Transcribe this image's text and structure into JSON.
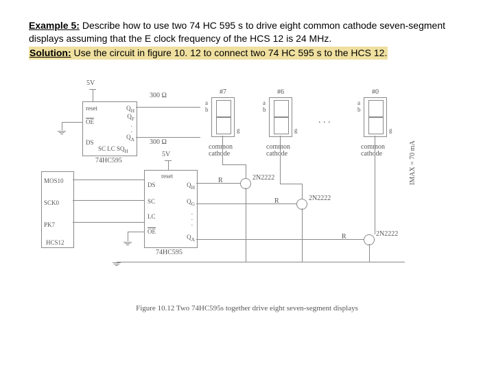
{
  "header": {
    "example_label": "Example 5:",
    "problem": " Describe how to use two 74 HC 595 s to drive eight common cathode seven-segment displays assuming that the E clock frequency of the HCS 12 is 24 MHz.",
    "solution_label": "Solution:",
    "solution_text": " Use the circuit in figure 10. 12 to connect two 74 HC 595 s to the HCS 12."
  },
  "diagram": {
    "supply1": "5V",
    "supply2": "5V",
    "chip1": {
      "name": "74HC595",
      "pins_left": [
        "OE",
        "DS",
        "SC",
        "LC",
        "SQH"
      ],
      "pins_right_top": "QH",
      "pins_right_bottom": "QA",
      "reset": "reset"
    },
    "chip2": {
      "name": "74HC595",
      "pins_left": [
        "DS",
        "SC",
        "LC",
        "OE"
      ],
      "pins_right_top": "QH",
      "pins_right_mid": "QG",
      "pins_right_bottom": "QA",
      "reset": "reset"
    },
    "mcu": {
      "name": "HCS12",
      "pins": [
        "MOS10",
        "SCK0",
        "PK7"
      ]
    },
    "resistors": {
      "top": "300 Ω",
      "bottom": "300 Ω",
      "base": "R"
    },
    "displays": [
      {
        "num": "#7",
        "cathode": "common\ncathode",
        "a": "a",
        "b": "b",
        "g": "g"
      },
      {
        "num": "#6",
        "cathode": "common\ncathode",
        "a": "a",
        "b": "b",
        "g": "g"
      },
      {
        "num": "#0",
        "cathode": "common\ncathode",
        "a": "a",
        "b": "b",
        "g": "g"
      }
    ],
    "transistor": "2N2222",
    "imax": "IMAX = 70 mA",
    "caption": "Figure 10.12 Two 74HC595s together drive eight seven-segment displays"
  }
}
